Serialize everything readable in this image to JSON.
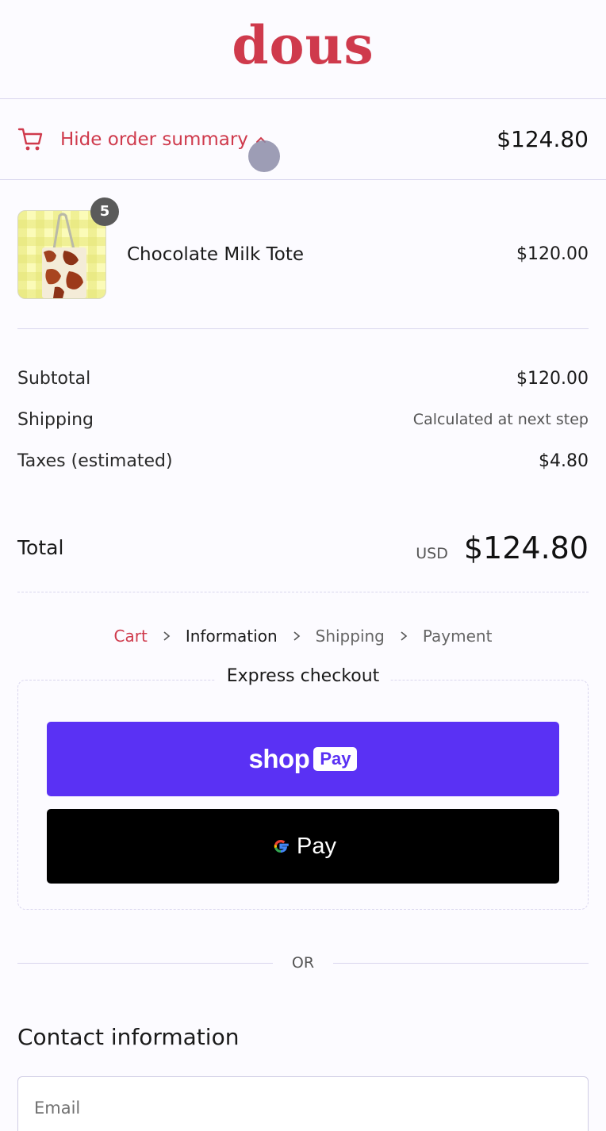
{
  "brand": {
    "logo": "dous",
    "accent": "#cf3a4c"
  },
  "summary_toggle": {
    "label": "Hide order summary",
    "total": "$124.80",
    "icon": "cart-icon"
  },
  "line_item": {
    "name": "Chocolate Milk Tote",
    "quantity": "5",
    "price": "$120.00"
  },
  "costs": {
    "subtotal_label": "Subtotal",
    "subtotal_value": "$120.00",
    "shipping_label": "Shipping",
    "shipping_value": "Calculated at next step",
    "taxes_label": "Taxes (estimated)",
    "taxes_value": "$4.80"
  },
  "total": {
    "label": "Total",
    "currency": "USD",
    "amount": "$124.80"
  },
  "breadcrumb": [
    "Cart",
    "Information",
    "Shipping",
    "Payment"
  ],
  "express": {
    "title": "Express checkout",
    "shop_pay_word": "shop",
    "shop_pay_box": "Pay",
    "shop_pay_color": "#5a31f4",
    "gpay_word": "Pay"
  },
  "divider": {
    "text": "OR"
  },
  "contact": {
    "title": "Contact information",
    "email_placeholder": "Email"
  }
}
